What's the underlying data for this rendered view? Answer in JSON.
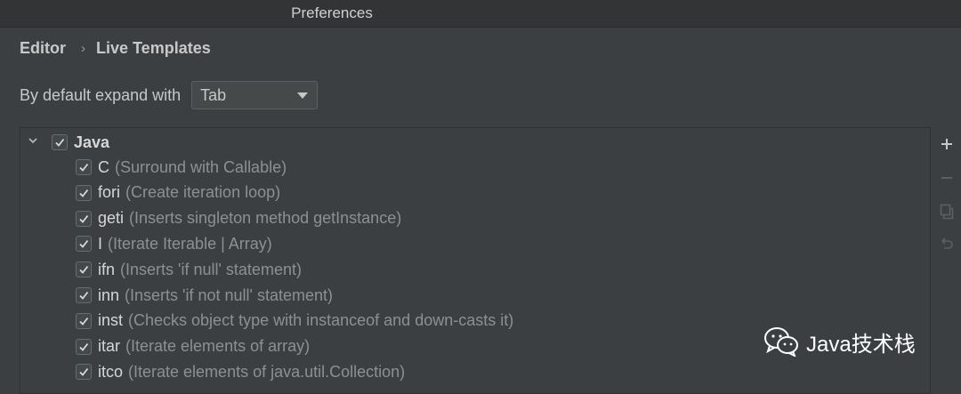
{
  "window": {
    "title": "Preferences"
  },
  "breadcrumb": {
    "parent": "Editor",
    "separator": "›",
    "current": "Live Templates"
  },
  "expand": {
    "label": "By default expand with",
    "selected": "Tab"
  },
  "tree": {
    "group": {
      "name": "Java",
      "checked": true,
      "expanded": true
    },
    "templates": [
      {
        "abbr": "C",
        "desc": "(Surround with Callable)",
        "checked": true
      },
      {
        "abbr": "fori",
        "desc": "(Create iteration loop)",
        "checked": true
      },
      {
        "abbr": "geti",
        "desc": "(Inserts singleton method getInstance)",
        "checked": true
      },
      {
        "abbr": "I",
        "desc": "(Iterate Iterable | Array)",
        "checked": true
      },
      {
        "abbr": "ifn",
        "desc": "(Inserts 'if null' statement)",
        "checked": true
      },
      {
        "abbr": "inn",
        "desc": "(Inserts 'if not null' statement)",
        "checked": true
      },
      {
        "abbr": "inst",
        "desc": "(Checks object type with instanceof and down-casts it)",
        "checked": true
      },
      {
        "abbr": "itar",
        "desc": "(Iterate elements of array)",
        "checked": true
      },
      {
        "abbr": "itco",
        "desc": "(Iterate elements of java.util.Collection)",
        "checked": true
      }
    ]
  },
  "toolbar": {
    "icons": [
      "add-icon",
      "remove-icon",
      "copy-icon",
      "restore-icon"
    ]
  },
  "watermark": {
    "text": "Java技术栈"
  },
  "colors": {
    "background": "#3c3f41",
    "titlebar": "#323436",
    "text": "#bbbbbb",
    "description": "#8f8f8f"
  }
}
